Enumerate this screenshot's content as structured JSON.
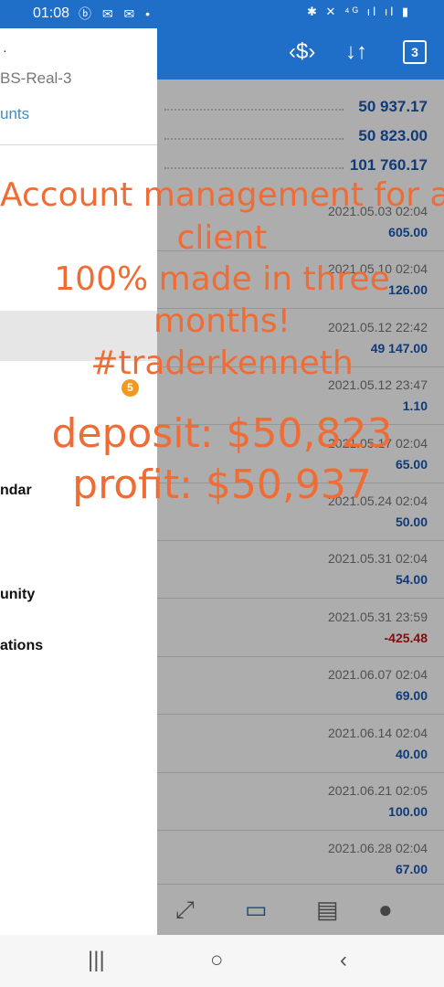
{
  "status_bar": {
    "time": "01:08",
    "left_icons": [
      "ⓑ",
      "✉",
      "✉",
      "•"
    ],
    "right_icons": "✱ ✕ ⁴ᴳ ıl ıl ▮"
  },
  "toolbar": {
    "convert_icon": "‹$›",
    "sort_icon": "↓↑",
    "calendar_day": "3"
  },
  "summary": [
    {
      "value": "50 937.17"
    },
    {
      "value": "50 823.00"
    },
    {
      "value": "101 760.17"
    }
  ],
  "deals": [
    {
      "date": "2021.05.03 02:04",
      "amount": "605.00",
      "negative": false
    },
    {
      "date": "2021.05.10 02:04",
      "amount": "126.00",
      "negative": false
    },
    {
      "date": "2021.05.12 22:42",
      "amount": "49 147.00",
      "negative": false
    },
    {
      "date": "2021.05.12 23:47",
      "amount": "1.10",
      "negative": false
    },
    {
      "date": "2021.05.17 02:04",
      "amount": "65.00",
      "negative": false
    },
    {
      "date": "2021.05.24 02:04",
      "amount": "50.00",
      "negative": false
    },
    {
      "date": "2021.05.31 02:04",
      "amount": "54.00",
      "negative": false
    },
    {
      "date": "2021.05.31 23:59",
      "amount": "-425.48",
      "negative": true
    },
    {
      "date": "2021.06.07 02:04",
      "amount": "69.00",
      "negative": false
    },
    {
      "date": "2021.06.14 02:04",
      "amount": "40.00",
      "negative": false
    },
    {
      "date": "2021.06.21 02:05",
      "amount": "100.00",
      "negative": false
    },
    {
      "date": "2021.06.28 02:04",
      "amount": "67.00",
      "negative": false
    }
  ],
  "drawer": {
    "account_name": "·",
    "server": "BS-Real-3",
    "accounts_link": "unts",
    "badge": "5",
    "items": [
      "ndar",
      "unity",
      "ations"
    ]
  },
  "overlay": {
    "line1": "Account management for a",
    "line2": "client",
    "line3": "100% made in three",
    "line4": "months!",
    "line5": "#traderkenneth",
    "line6": "deposit: $50,823",
    "line7": "profit: $50,937"
  },
  "bottom_tabs": [
    {
      "icon": "chart-trend-icon",
      "glyph": "⤢"
    },
    {
      "icon": "inbox-icon",
      "glyph": "▭"
    },
    {
      "icon": "news-icon",
      "glyph": "▤"
    },
    {
      "icon": "chat-icon",
      "glyph": "●"
    }
  ],
  "nav_bar": {
    "recents": "|||",
    "home": "○",
    "back": "‹"
  }
}
